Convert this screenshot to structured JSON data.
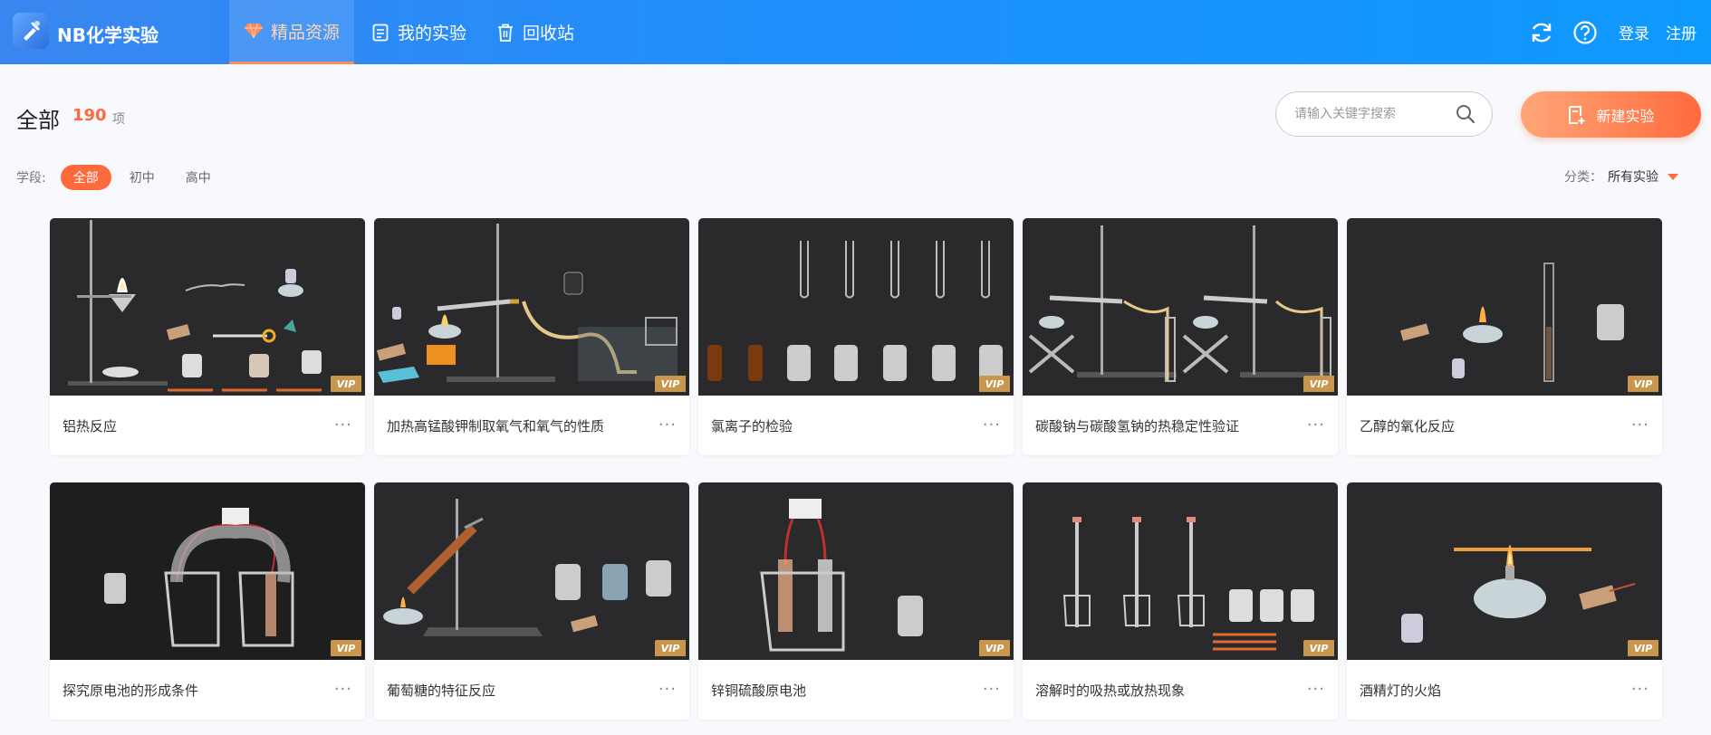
{
  "app": {
    "title": "NB化学实验"
  },
  "nav": [
    {
      "label": "精品资源",
      "icon": "gem-icon",
      "active": true
    },
    {
      "label": "我的实验",
      "icon": "document-icon"
    },
    {
      "label": "回收站",
      "icon": "trash-icon"
    }
  ],
  "topbar": {
    "login": "登录",
    "register": "注册"
  },
  "header": {
    "title": "全部",
    "count": "190",
    "count_unit": "项"
  },
  "search": {
    "placeholder": "请输入关键字搜索"
  },
  "new_button": {
    "label": "新建实验"
  },
  "filter": {
    "label": "学段:",
    "options": [
      "全部",
      "初中",
      "高中"
    ],
    "selected": "全部"
  },
  "category": {
    "label": "分类：",
    "value": "所有实验"
  },
  "badge": "VIP",
  "more_label": "···",
  "colors": {
    "accent": "#ff6a3d",
    "topbar": "#1f8ffb",
    "vip": "#c9964d"
  },
  "cards": [
    {
      "title": "铝热反应"
    },
    {
      "title": "加热高锰酸钾制取氧气和氧气的性质"
    },
    {
      "title": "氯离子的检验"
    },
    {
      "title": "碳酸钠与碳酸氢钠的热稳定性验证"
    },
    {
      "title": "乙醇的氧化反应"
    },
    {
      "title": "探究原电池的形成条件"
    },
    {
      "title": "葡萄糖的特征反应"
    },
    {
      "title": "锌铜硫酸原电池"
    },
    {
      "title": "溶解时的吸热或放热现象"
    },
    {
      "title": "酒精灯的火焰"
    }
  ]
}
